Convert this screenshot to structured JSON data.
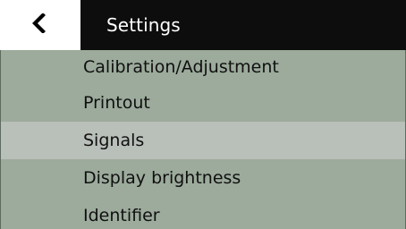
{
  "header": {
    "back_icon": "chevron-left-icon",
    "title": "Settings"
  },
  "menu": {
    "selected_index": 2,
    "items": [
      {
        "label": "Calibration/Adjustment"
      },
      {
        "label": "Printout"
      },
      {
        "label": "Signals"
      },
      {
        "label": "Display brightness"
      },
      {
        "label": "Identifier"
      }
    ]
  },
  "colors": {
    "header_bg": "#0d0d0d",
    "list_bg": "#9cab9c",
    "selected_bg": "#b9bfb9"
  }
}
